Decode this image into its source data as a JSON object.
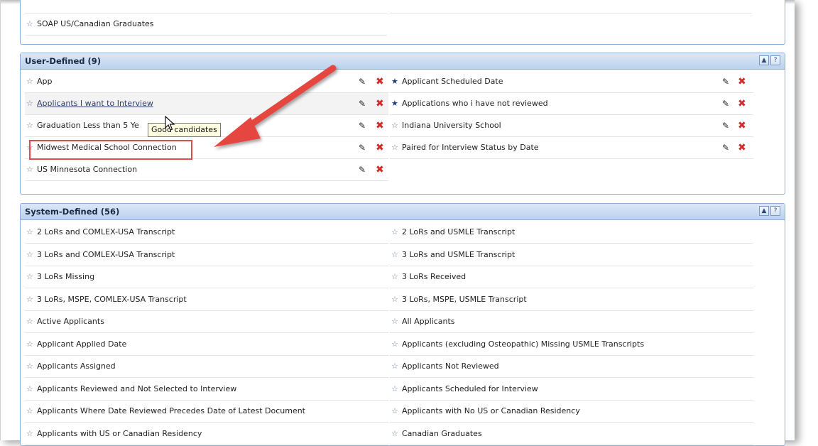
{
  "top_panel": {
    "item": "SOAP US/Canadian Graduates"
  },
  "user_defined": {
    "title": "User-Defined (9)",
    "left": [
      {
        "label": "App"
      },
      {
        "label": "Applicants I want to Interview"
      },
      {
        "label": "Graduation Less than 5 Ye"
      },
      {
        "label": "Midwest Medical School Connection"
      },
      {
        "label": "US Minnesota Connection"
      }
    ],
    "right": [
      {
        "label": "Applicant Scheduled Date"
      },
      {
        "label": "Applications who i have not reviewed"
      },
      {
        "label": "Indiana University School"
      },
      {
        "label": "Paired for Interview Status by Date"
      }
    ]
  },
  "tooltip": "Good candidates",
  "system_defined": {
    "title": "System-Defined (56)",
    "left": [
      "2 LoRs and COMLEX-USA Transcript",
      "3 LoRs and COMLEX-USA Transcript",
      "3 LoRs Missing",
      "3 LoRs, MSPE, COMLEX-USA Transcript",
      "Active Applicants",
      "Applicant Applied Date",
      "Applicants Assigned",
      "Applicants Reviewed and Not Selected to Interview",
      "Applicants Where Date Reviewed Precedes Date of Latest Document",
      "Applicants with US or Canadian Residency"
    ],
    "right": [
      "2 LoRs and USMLE Transcript",
      "3 LoRs and USMLE Transcript",
      "3 LoRs Received",
      "3 LoRs, MSPE, USMLE Transcript",
      "All Applicants",
      "Applicants (excluding Osteopathic) Missing USMLE Transcripts",
      "Applicants Not Reviewed",
      "Applicants Scheduled for Interview",
      "Applicants with No US or Canadian Residency",
      "Canadian Graduates"
    ]
  },
  "panel_buttons": {
    "collapse": "▲",
    "help": "?"
  },
  "colors": {
    "accent": "#8fb0d6",
    "delete": "#d12b2b",
    "annotation": "#e04a4a"
  }
}
